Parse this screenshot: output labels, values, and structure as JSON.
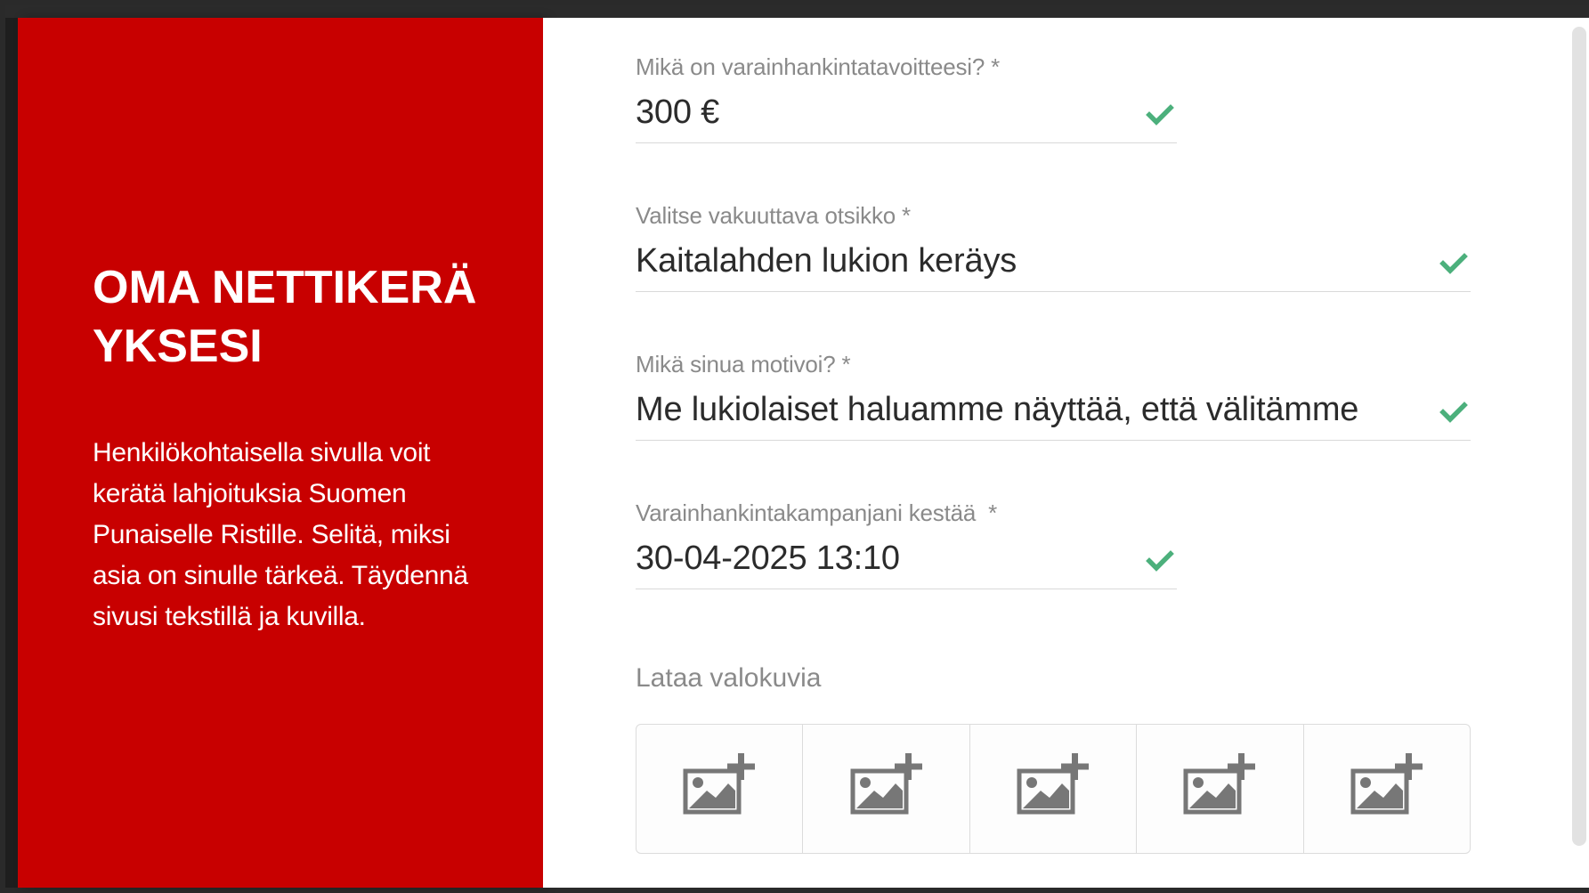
{
  "sidebar": {
    "title": "OMA NETTIKERÄYKSESI",
    "description": "Henkilökohtaisella sivulla voit kerätä lahjoituksia Suomen Punaiselle Ristille. Selitä, miksi asia on sinulle tärkeä. Täydennä sivusi tekstillä ja kuvilla."
  },
  "form": {
    "goal": {
      "label": "Mikä on varainhankintatavoitteesi? *",
      "value": "300 €"
    },
    "headline": {
      "label": "Valitse vakuuttava otsikko *",
      "value": "Kaitalahden lukion keräys"
    },
    "motivation": {
      "label": "Mikä sinua motivoi? *",
      "value": "Me lukiolaiset haluamme näyttää, että välitämme"
    },
    "duration": {
      "label": "Varainhankintakampanjani kestää  *",
      "value": "30-04-2025 13:10"
    },
    "upload": {
      "label": "Lataa valokuvia",
      "slots": [
        "add-image-icon",
        "add-image-icon",
        "add-image-icon",
        "add-image-icon",
        "add-image-icon"
      ]
    }
  },
  "colors": {
    "brand_red": "#c80000",
    "check_green": "#4cb07c",
    "icon_gray": "#777777"
  }
}
